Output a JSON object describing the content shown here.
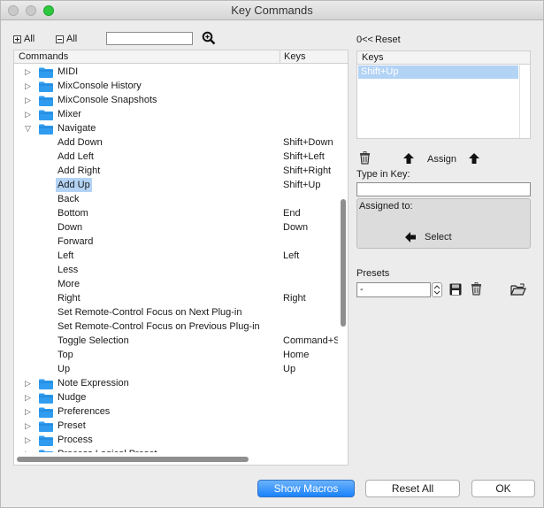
{
  "window": {
    "title": "Key Commands"
  },
  "toolbar": {
    "expand_all": "All",
    "collapse_all": "All",
    "search_value": ""
  },
  "tree": {
    "headers": {
      "commands": "Commands",
      "keys": "Keys"
    },
    "rows": [
      {
        "type": "group",
        "label": "MIDI",
        "expanded": false
      },
      {
        "type": "group",
        "label": "MixConsole History",
        "expanded": false
      },
      {
        "type": "group",
        "label": "MixConsole Snapshots",
        "expanded": false
      },
      {
        "type": "group",
        "label": "Mixer",
        "expanded": false
      },
      {
        "type": "group",
        "label": "Navigate",
        "expanded": true
      },
      {
        "type": "cmd",
        "label": "Add Down",
        "key": "Shift+Down"
      },
      {
        "type": "cmd",
        "label": "Add Left",
        "key": "Shift+Left"
      },
      {
        "type": "cmd",
        "label": "Add Right",
        "key": "Shift+Right"
      },
      {
        "type": "cmd",
        "label": "Add Up",
        "key": "Shift+Up",
        "selected": true
      },
      {
        "type": "cmd",
        "label": "Back",
        "key": ""
      },
      {
        "type": "cmd",
        "label": "Bottom",
        "key": "End"
      },
      {
        "type": "cmd",
        "label": "Down",
        "key": "Down"
      },
      {
        "type": "cmd",
        "label": "Forward",
        "key": ""
      },
      {
        "type": "cmd",
        "label": "Left",
        "key": "Left"
      },
      {
        "type": "cmd",
        "label": "Less",
        "key": ""
      },
      {
        "type": "cmd",
        "label": "More",
        "key": ""
      },
      {
        "type": "cmd",
        "label": "Right",
        "key": "Right"
      },
      {
        "type": "cmd",
        "label": "Set Remote-Control Focus on Next Plug-in",
        "key": ""
      },
      {
        "type": "cmd",
        "label": "Set Remote-Control Focus on Previous Plug-in",
        "key": ""
      },
      {
        "type": "cmd",
        "label": "Toggle Selection",
        "key": "Command+S"
      },
      {
        "type": "cmd",
        "label": "Top",
        "key": "Home"
      },
      {
        "type": "cmd",
        "label": "Up",
        "key": "Up"
      },
      {
        "type": "group",
        "label": "Note Expression",
        "expanded": false
      },
      {
        "type": "group",
        "label": "Nudge",
        "expanded": false
      },
      {
        "type": "group",
        "label": "Preferences",
        "expanded": false
      },
      {
        "type": "group",
        "label": "Preset",
        "expanded": false
      },
      {
        "type": "group",
        "label": "Process",
        "expanded": false
      },
      {
        "type": "group",
        "label": "Process Logical Preset",
        "expanded": false
      }
    ]
  },
  "right": {
    "reset_arrows": "0<<",
    "reset_label": "Reset",
    "keys_header": "Keys",
    "keys_items": [
      "Shift+Up"
    ],
    "assign_label": "Assign",
    "type_in_key_label": "Type in Key:",
    "type_in_key_value": "",
    "assigned_to_label": "Assigned to:",
    "select_label": "Select",
    "presets_label": "Presets",
    "preset_value": "-"
  },
  "footer": {
    "show_macros": "Show Macros",
    "reset_all": "Reset All",
    "ok": "OK"
  },
  "colors": {
    "folder": "#2f9cf0",
    "selection": "#b3d3f5",
    "primary": "#1a82fb"
  }
}
